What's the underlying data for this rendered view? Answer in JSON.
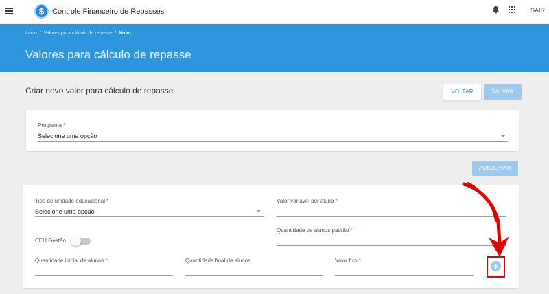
{
  "topbar": {
    "app_title": "Controle Financeiro de Repasses",
    "logo_glyph": "$",
    "logout_label": "SAIR",
    "icons": [
      "menu-icon",
      "bell-icon",
      "apps-grid-icon"
    ]
  },
  "breadcrumb": {
    "items": [
      "Início",
      "Valores para cálculo de repasse",
      "Novo"
    ],
    "separator": "/"
  },
  "page_title": "Valores para cálculo de repasse",
  "form": {
    "title": "Criar novo valor para cálculo de repasse",
    "back_label": "VOLTAR",
    "save_label": "SALVAR",
    "add_label": "ADICIONAR"
  },
  "programa": {
    "label": "Programa",
    "value": "Selecione uma opção"
  },
  "item": {
    "tipo_unidade": {
      "label": "Tipo de unidade educacional",
      "value": "Selecione uma opção"
    },
    "valor_variavel": {
      "label": "Valor variável por aluno",
      "value": ""
    },
    "quantidade_padrao": {
      "label": "Quantidade de alunos padrão",
      "value": ""
    },
    "ceu_gestao": {
      "label": "CEU Gestão",
      "enabled": false
    },
    "quantidade_inicial": {
      "label": "Quantidade inicial de alunos",
      "value": ""
    },
    "quantidade_final": {
      "label": "Quantidade final de alunos",
      "value": ""
    },
    "valor_fixo": {
      "label": "Valor fixo",
      "value": ""
    },
    "add_glyph": "+"
  },
  "required_marker": "*",
  "colors": {
    "primary": "#2e96de",
    "disabled_button": "#9cc9ec",
    "annotation": "#e00000"
  }
}
